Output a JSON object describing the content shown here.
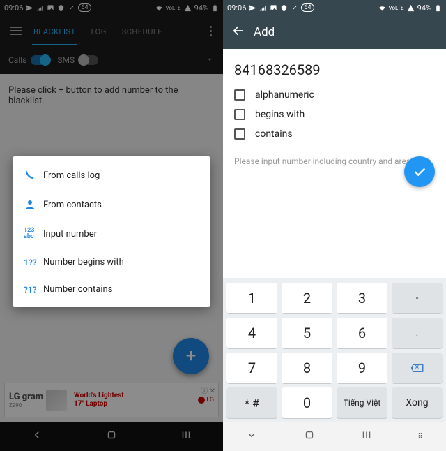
{
  "status": {
    "time": "09:06",
    "battery": "94%",
    "net": "VoLTE",
    "speed": "64"
  },
  "left": {
    "tabs": [
      "BLACKLIST",
      "LOG",
      "SCHEDULE"
    ],
    "toggles": {
      "calls": "Calls",
      "sms": "SMS"
    },
    "hint": "Please click + button to add number to the blacklist.",
    "menu": {
      "calls_log": "From calls log",
      "contacts": "From contacts",
      "input_number": "Input number",
      "begins_with": "Number begins with",
      "contains": "Number contains",
      "icon_input": "123\nabc",
      "icon_begins": "1??",
      "icon_contains": "?1?"
    },
    "ad": {
      "brand": "LG gram",
      "model": "Z990",
      "tag1": "World's Lightest",
      "tag2": "17\" Laptop",
      "logo": "LG"
    }
  },
  "right": {
    "title": "Add",
    "number": "84168326589",
    "opts": {
      "alpha": "alphanumeric",
      "begins": "begins with",
      "contains": "contains"
    },
    "help": "Please input number including country and area code.",
    "keys": {
      "r1": [
        "1",
        "2",
        "3",
        "-"
      ],
      "r2": [
        "4",
        "5",
        "6",
        "."
      ],
      "r3": [
        "7",
        "8",
        "9"
      ],
      "r4": [
        "* #",
        "0",
        "Tiếng Việt",
        "Xong"
      ]
    }
  }
}
